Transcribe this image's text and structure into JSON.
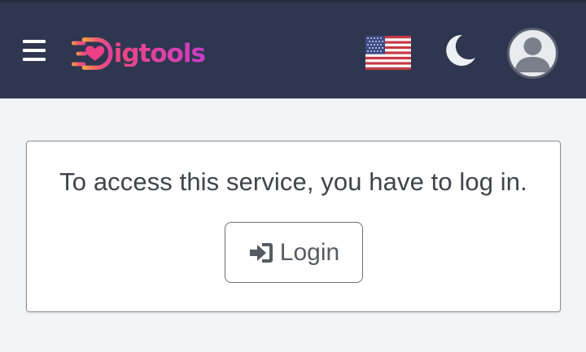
{
  "header": {
    "logo_text": "igtools",
    "icons": {
      "menu": "menu-icon",
      "flag": "us-flag-icon",
      "theme": "moon-icon",
      "profile": "user-avatar-icon"
    },
    "colors": {
      "bar": "#2f3650",
      "logo_start": "#f0477f",
      "logo_end": "#c93cc8"
    }
  },
  "main": {
    "message": "To access this service, you have to log in.",
    "login_button_label": "Login",
    "login_icon": "sign-in-icon"
  }
}
